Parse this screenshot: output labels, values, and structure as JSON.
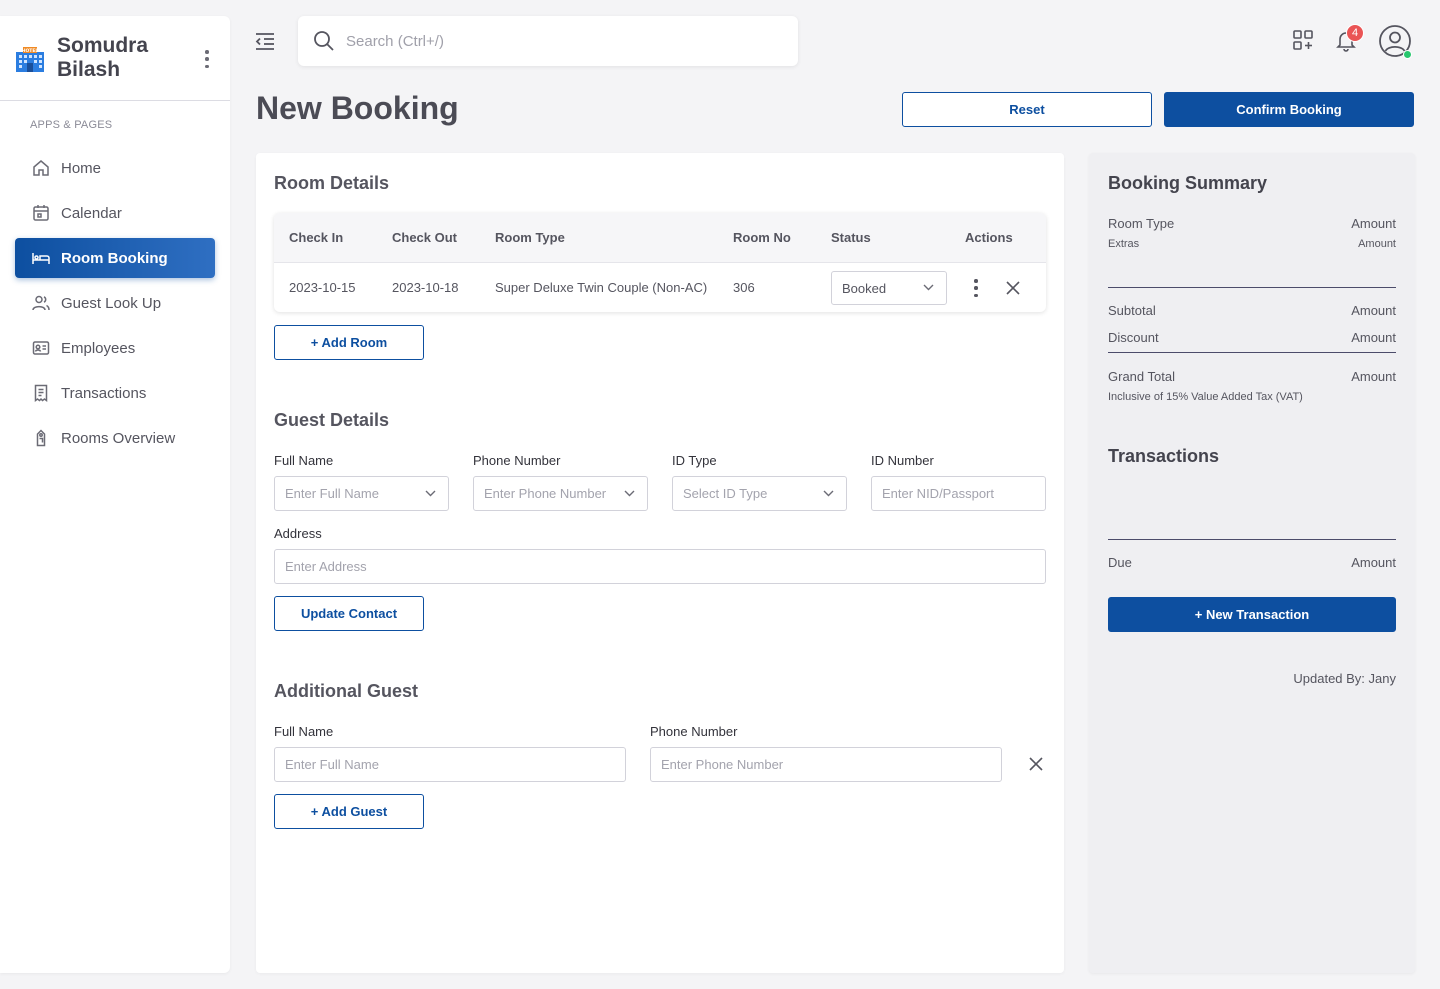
{
  "app": {
    "name": "Somudra Bilash",
    "name_line1": "Somudra",
    "name_line2": "Bilash",
    "logo_text": "HOTEL"
  },
  "sidebar": {
    "section_label": "APPS & PAGES",
    "items": [
      {
        "label": "Home",
        "icon": "home-icon",
        "active": false
      },
      {
        "label": "Calendar",
        "icon": "calendar-icon",
        "active": false
      },
      {
        "label": "Room Booking",
        "icon": "bed-icon",
        "active": true
      },
      {
        "label": "Guest Look Up",
        "icon": "users-icon",
        "active": false
      },
      {
        "label": "Employees",
        "icon": "id-card-icon",
        "active": false
      },
      {
        "label": "Transactions",
        "icon": "receipt-icon",
        "active": false
      },
      {
        "label": "Rooms Overview",
        "icon": "room-tag-icon",
        "active": false
      }
    ]
  },
  "topbar": {
    "search_placeholder": "Search (Ctrl+/)",
    "notification_count": "4"
  },
  "page": {
    "title": "New Booking",
    "reset_label": "Reset",
    "confirm_label": "Confirm Booking"
  },
  "room_details": {
    "title": "Room Details",
    "columns": [
      "Check In",
      "Check Out",
      "Room Type",
      "Room No",
      "Status",
      "Actions"
    ],
    "rows": [
      {
        "check_in": "2023-10-15",
        "check_out": "2023-10-18",
        "room_type": "Super Deluxe Twin Couple (Non-AC)",
        "room_no": "306",
        "status": "Booked"
      }
    ],
    "add_room_label": "+ Add Room"
  },
  "guest_details": {
    "title": "Guest Details",
    "full_name_label": "Full Name",
    "full_name_placeholder": "Enter Full Name",
    "phone_label": "Phone Number",
    "phone_placeholder": "Enter Phone Number",
    "id_type_label": "ID Type",
    "id_type_placeholder": "Select ID Type",
    "id_number_label": "ID Number",
    "id_number_placeholder": "Enter NID/Passport",
    "address_label": "Address",
    "address_placeholder": "Enter Address",
    "update_contact_label": "Update Contact"
  },
  "additional_guest": {
    "title": "Additional Guest",
    "full_name_label": "Full Name",
    "full_name_placeholder": "Enter Full Name",
    "phone_label": "Phone Number",
    "phone_placeholder": "Enter Phone Number",
    "add_guest_label": "+ Add Guest"
  },
  "summary": {
    "title": "Booking Summary",
    "room_type_label": "Room Type",
    "room_type_value": "Amount",
    "extras_label": "Extras",
    "extras_value": "Amount",
    "subtotal_label": "Subtotal",
    "subtotal_value": "Amount",
    "discount_label": "Discount",
    "discount_value": "Amount",
    "grand_total_label": "Grand Total",
    "grand_total_value": "Amount",
    "vat_note": "Inclusive of 15% Value Added Tax (VAT)",
    "transactions_title": "Transactions",
    "due_label": "Due",
    "due_value": "Amount",
    "new_transaction_label": "+ New Transaction",
    "updated_by": "Updated By: Jany"
  },
  "colors": {
    "primary": "#0d4fa0",
    "badge": "#ea5455",
    "online": "#28c76f",
    "summary_bg": "#efeff2"
  }
}
